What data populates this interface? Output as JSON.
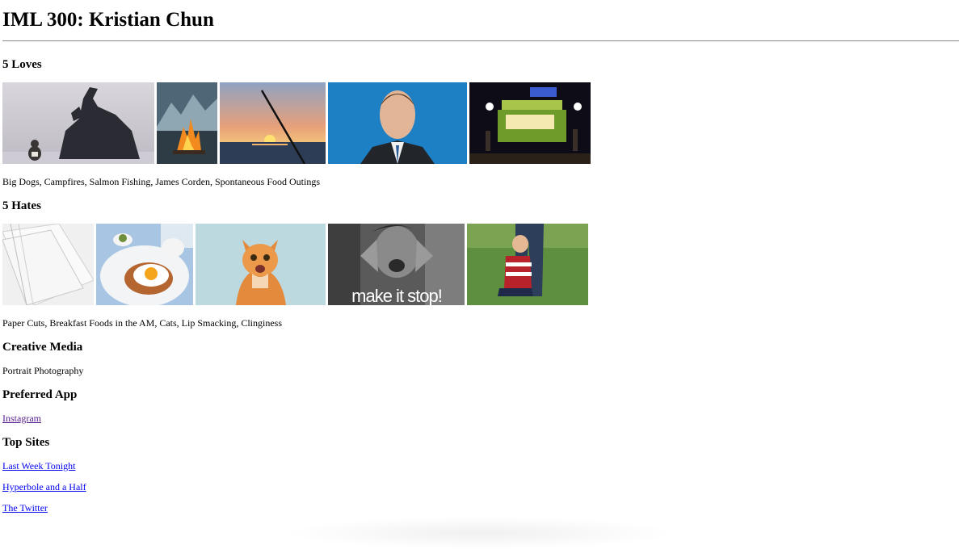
{
  "page": {
    "title": "IML 300: Kristian Chun"
  },
  "loves": {
    "heading": "5 Loves",
    "images": [
      {
        "name": "big-dog-photo"
      },
      {
        "name": "campfire-photo"
      },
      {
        "name": "salmon-fishing-photo"
      },
      {
        "name": "james-corden-photo"
      },
      {
        "name": "food-truck-photo"
      }
    ],
    "caption": "Big Dogs, Campfires, Salmon Fishing, James Corden, Spontaneous Food Outings"
  },
  "hates": {
    "heading": "5 Hates",
    "images": [
      {
        "name": "paper-photo"
      },
      {
        "name": "breakfast-photo"
      },
      {
        "name": "cat-photo"
      },
      {
        "name": "make-it-stop-photo",
        "overlay_text": "make it stop!"
      },
      {
        "name": "clingy-child-photo"
      }
    ],
    "caption": "Paper Cuts, Breakfast Foods in the AM, Cats, Lip Smacking, Clinginess"
  },
  "creative_media": {
    "heading": "Creative Media",
    "value": "Portrait Photography"
  },
  "preferred_app": {
    "heading": "Preferred App",
    "link": "Instagram"
  },
  "top_sites": {
    "heading": "Top Sites",
    "links": [
      "Last Week Tonight",
      "Hyperbole and a Half",
      "The Twitter"
    ]
  },
  "colors": {
    "link": "#0000ee",
    "visited_link": "#551a8b",
    "rule": "#9a9a9a"
  }
}
